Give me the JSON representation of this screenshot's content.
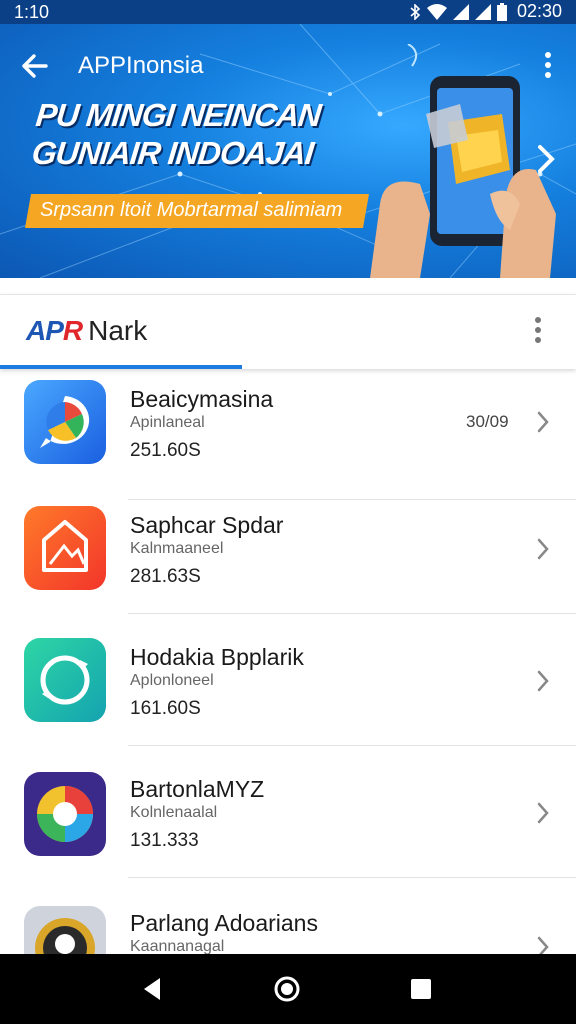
{
  "status_bar": {
    "time_left": "1:10",
    "time_right": "02:30"
  },
  "header": {
    "title": "APPInonsia",
    "headline_line1": "PU MINGI NEINCAN",
    "headline_line2": "GUNIAIR INDOAJAI",
    "ribbon_text": "Srpsann ltoit Mobrtarmal salimiam"
  },
  "tab": {
    "logo_mark_blue": "AP",
    "logo_mark_red": "R",
    "logo_name": "Nark"
  },
  "apps": [
    {
      "name": "Beaicymasina",
      "subtitle": "Apinlaneal",
      "size": "251.60S",
      "extra": "30/09"
    },
    {
      "name": "Saphcar Spdar",
      "subtitle": "Kalnmaaneel",
      "size": "281.63S",
      "extra": ""
    },
    {
      "name": "Hodakia Bpplarik",
      "subtitle": "Aplonloneel",
      "size": "161.60S",
      "extra": ""
    },
    {
      "name": "BartonlaMYZ",
      "subtitle": "Kolnlenaalal",
      "size": "131.333",
      "extra": ""
    },
    {
      "name": "Parlang Adoarians",
      "subtitle": "Kaannanagal",
      "size": "",
      "extra": ""
    }
  ],
  "icons": {
    "brand_colors": [
      "#1e7be0",
      "#e0262b",
      "#f5a623"
    ]
  }
}
